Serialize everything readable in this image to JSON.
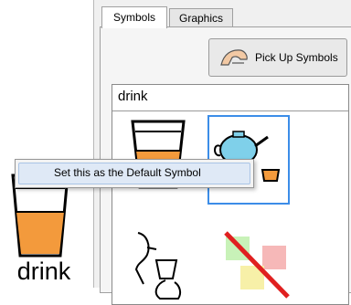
{
  "left_symbol": {
    "label": "drink",
    "icon": "glass-of-drink-icon"
  },
  "tabs": [
    {
      "label": "Symbols",
      "selected": true
    },
    {
      "label": "Graphics",
      "selected": false
    }
  ],
  "toolbar": {
    "pickup_label": "Pick Up Symbols",
    "pickup_icon": "hand-pickup-icon"
  },
  "symbol_search": {
    "value": "drink"
  },
  "symbols": [
    {
      "icon": "glass-of-drink-icon",
      "selected": false
    },
    {
      "icon": "teapot-cup-icon",
      "selected": true
    },
    {
      "icon": "person-drinking-icon",
      "selected": false
    },
    {
      "icon": "no-symbol-icon",
      "selected": false
    }
  ],
  "context_menu": {
    "items": [
      {
        "label": "Set this as the Default Symbol"
      }
    ]
  },
  "colors": {
    "selection": "#3c8de8",
    "drink": "#f39a3c"
  }
}
